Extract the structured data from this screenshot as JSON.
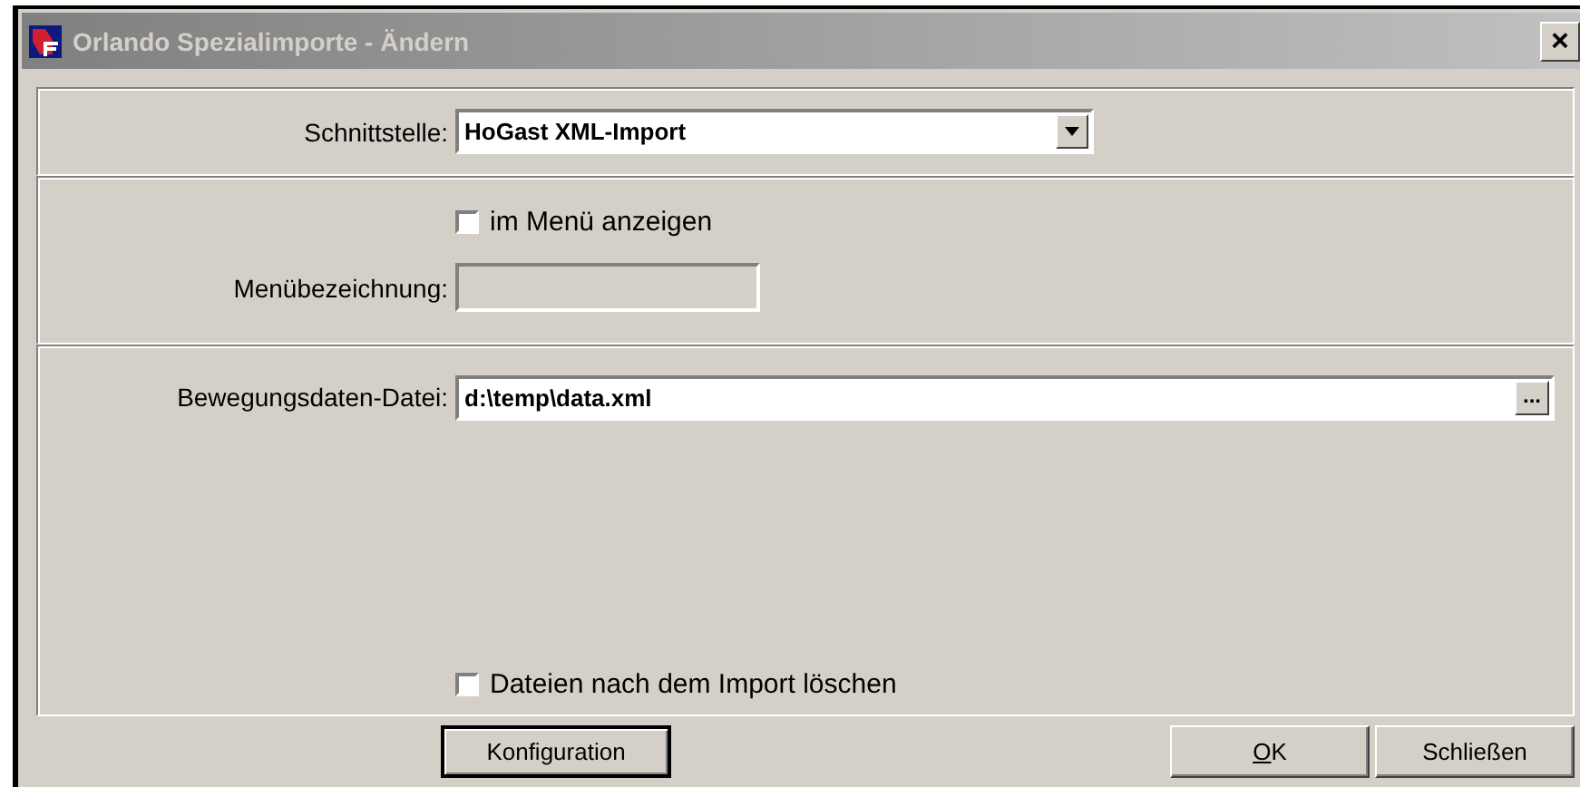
{
  "window": {
    "title": "Orlando Spezialimporte - Ändern",
    "close": "×"
  },
  "interface": {
    "label": "Schnittstelle:",
    "value": "HoGast XML-Import"
  },
  "menu": {
    "show_in_menu": {
      "label": "im Menü anzeigen",
      "checked": false
    },
    "name_label": "Menübezeichnung:",
    "name_disabled": true
  },
  "file": {
    "label": "Bewegungsdaten-Datei:",
    "value": "d:\\temp\\data.xml",
    "browse": "..."
  },
  "delete_after_import": {
    "label": "Dateien nach dem Import löschen",
    "checked": false
  },
  "buttons": [
    {
      "label": "Konfiguration",
      "kind": "left",
      "mnemonic": false
    },
    {
      "label": "OK",
      "kind": "right",
      "mnemonic": true
    },
    {
      "label": "Schließen",
      "kind": "right",
      "mnemonic": false
    }
  ]
}
